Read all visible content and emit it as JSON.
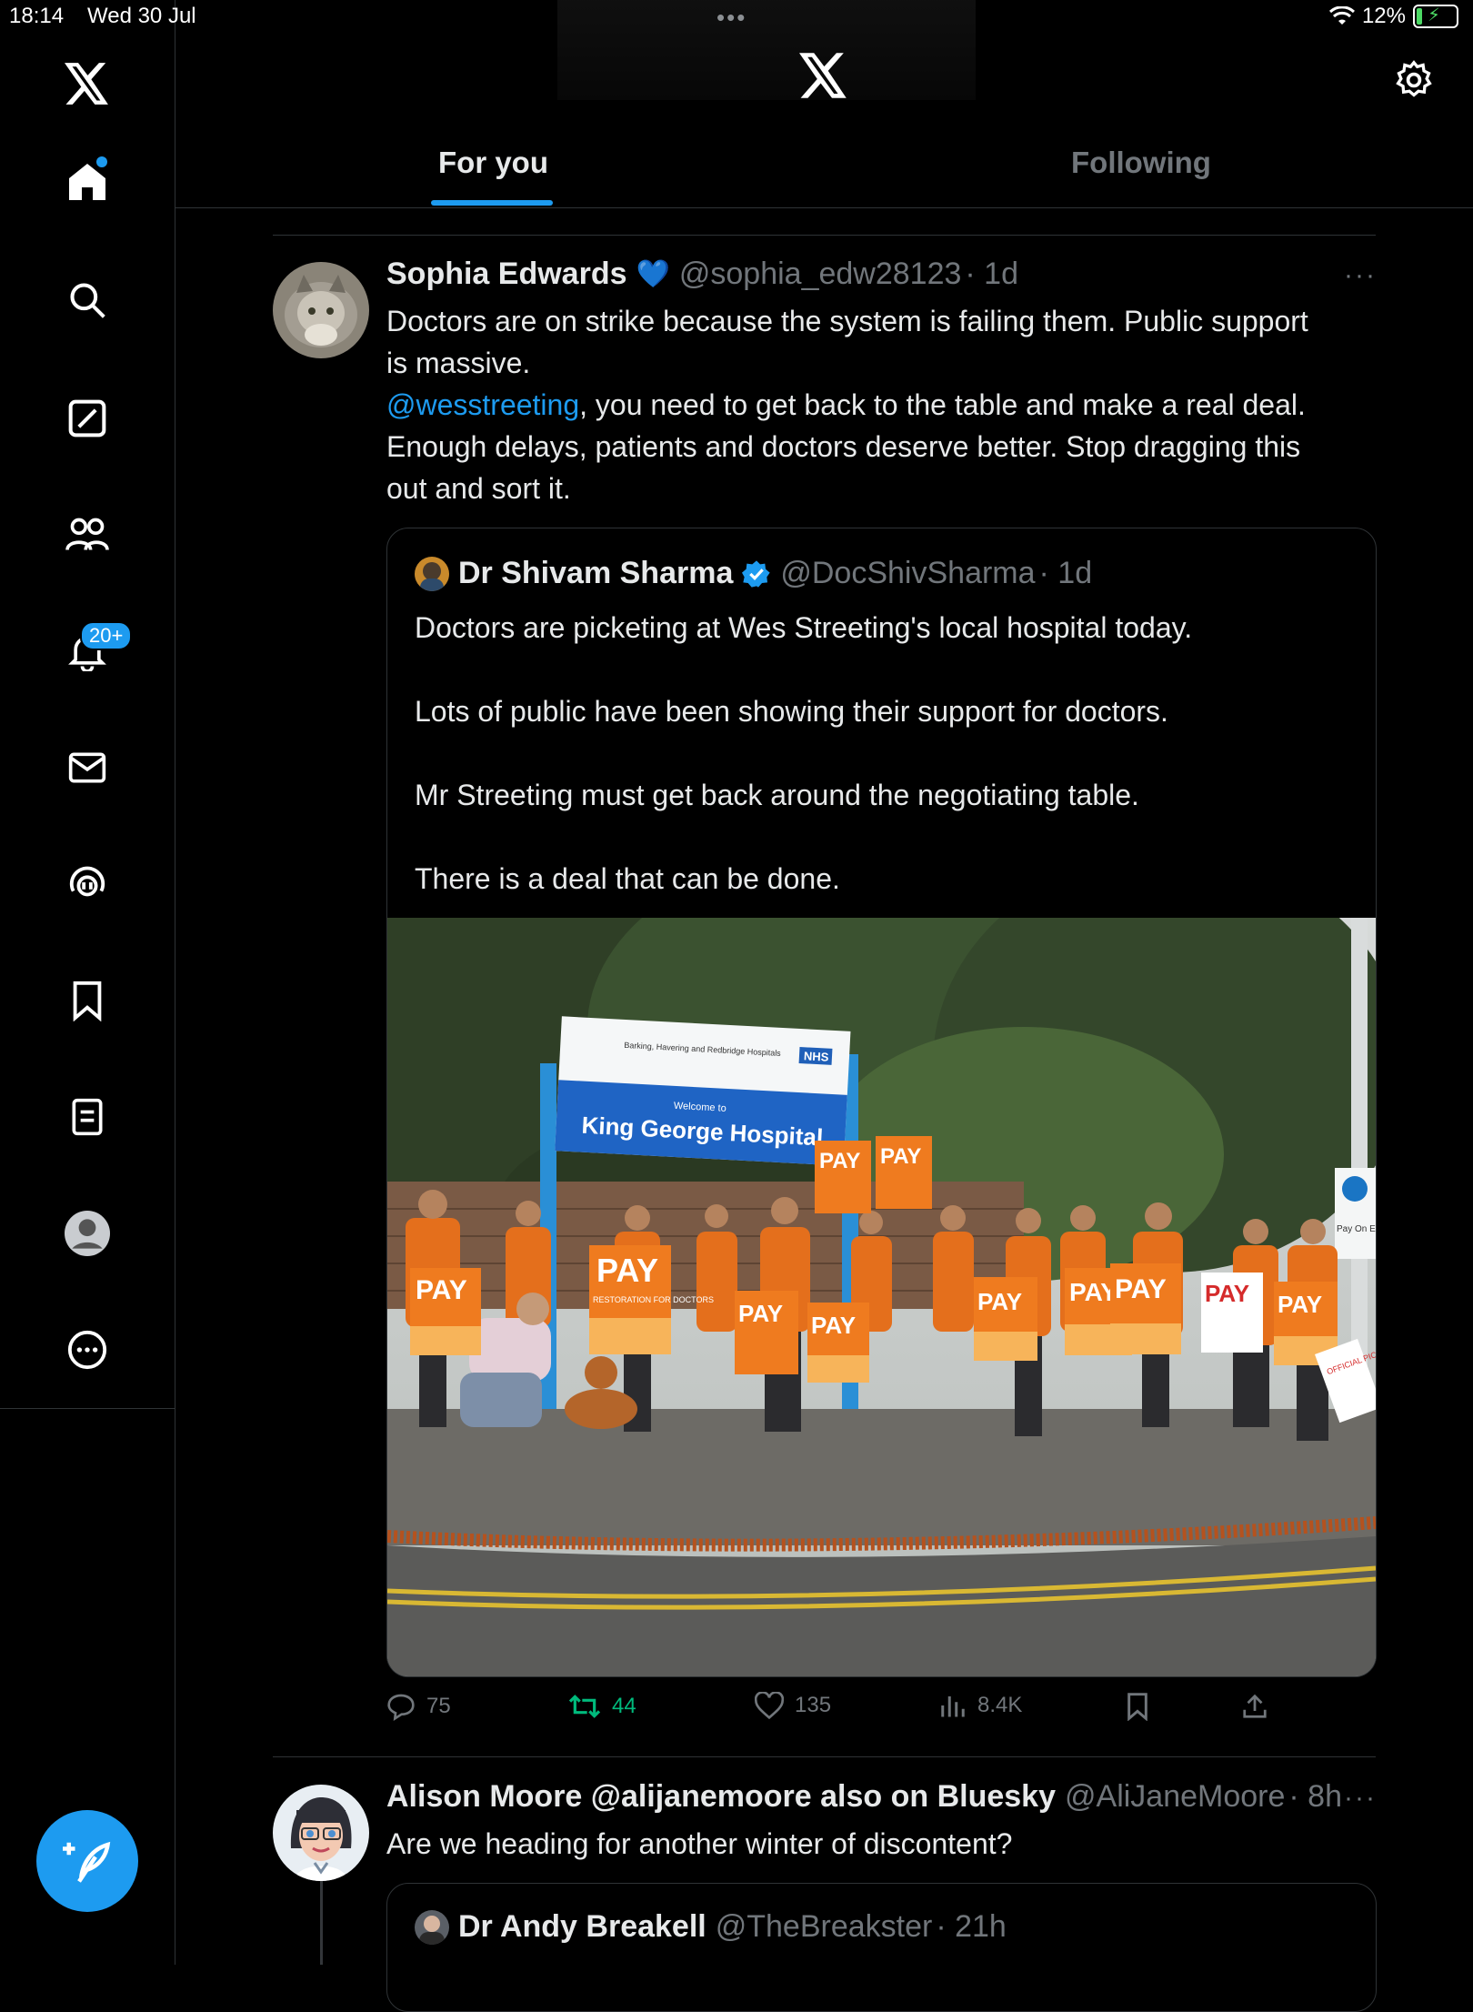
{
  "status_bar": {
    "time": "18:14",
    "date": "Wed 30 Jul",
    "dots": "•••",
    "battery_pct": "12%"
  },
  "sidebar": {
    "items": [
      {
        "name": "home",
        "icon": "home-icon"
      },
      {
        "name": "explore",
        "icon": "search-icon"
      },
      {
        "name": "grok",
        "icon": "grok-icon"
      },
      {
        "name": "communities",
        "icon": "communities-icon"
      },
      {
        "name": "notifications",
        "icon": "bell-icon",
        "badge": "20+"
      },
      {
        "name": "messages",
        "icon": "mail-icon"
      },
      {
        "name": "spaces",
        "icon": "spaces-icon"
      },
      {
        "name": "bookmarks",
        "icon": "bookmark-icon"
      },
      {
        "name": "lists",
        "icon": "list-icon"
      },
      {
        "name": "profile",
        "icon": "person-icon"
      },
      {
        "name": "more",
        "icon": "more-icon"
      }
    ],
    "compose_icon": "compose-icon"
  },
  "header": {
    "tabs": [
      {
        "label": "For you",
        "active": true
      },
      {
        "label": "Following",
        "active": false
      }
    ]
  },
  "tweets": [
    {
      "name": "Sophia Edwards",
      "emoji": "💙",
      "handle": "@sophia_edw28123",
      "time": "· 1d",
      "text_part1": "Doctors are on strike because the system is failing them. Public support\nis massive.",
      "mention": "@wesstreeting",
      "text_part2": ", you need to get back to the table and make a real deal.",
      "text_part3": "Enough delays, patients and doctors deserve better. Stop dragging this\nout and sort it.",
      "quote": {
        "name": "Dr Shivam Sharma",
        "verified": true,
        "handle": "@DocShivSharma",
        "time": "· 1d",
        "text": "Doctors are picketing at Wes Streeting's local hospital today.\n\nLots of public have been showing their support for doctors.\n\nMr Streeting must get back around the negotiating table.\n\nThere is a deal that can be done.",
        "image": {
          "sign_top": "Barking, Havering and Redbridge Hospitals",
          "sign_nhs": "NHS",
          "sign_welcome": "Welcome to",
          "sign_name": "King George Hospital",
          "placard_big": "PAY",
          "placard_small": "RESTORATION FOR DOCTORS",
          "pay_sign": "Pay On Exit",
          "official": "OFFICIAL PICKET"
        }
      },
      "stats": {
        "replies": "75",
        "reposts": "44",
        "likes": "135",
        "views": "8.4K"
      }
    },
    {
      "name": "Alison Moore @alijanemoore also on Bluesky",
      "handle": "@AliJaneMoore",
      "time": "· 8h",
      "text": "Are we heading for another winter of discontent?",
      "quote": {
        "name": "Dr Andy Breakell",
        "handle": "@TheBreakster",
        "time": "· 21h"
      }
    }
  ],
  "colors": {
    "accent": "#1d9bf0",
    "repost_green": "#00ba7c",
    "muted": "#71767b",
    "text": "#e7e9ea",
    "border": "#2f3336"
  }
}
